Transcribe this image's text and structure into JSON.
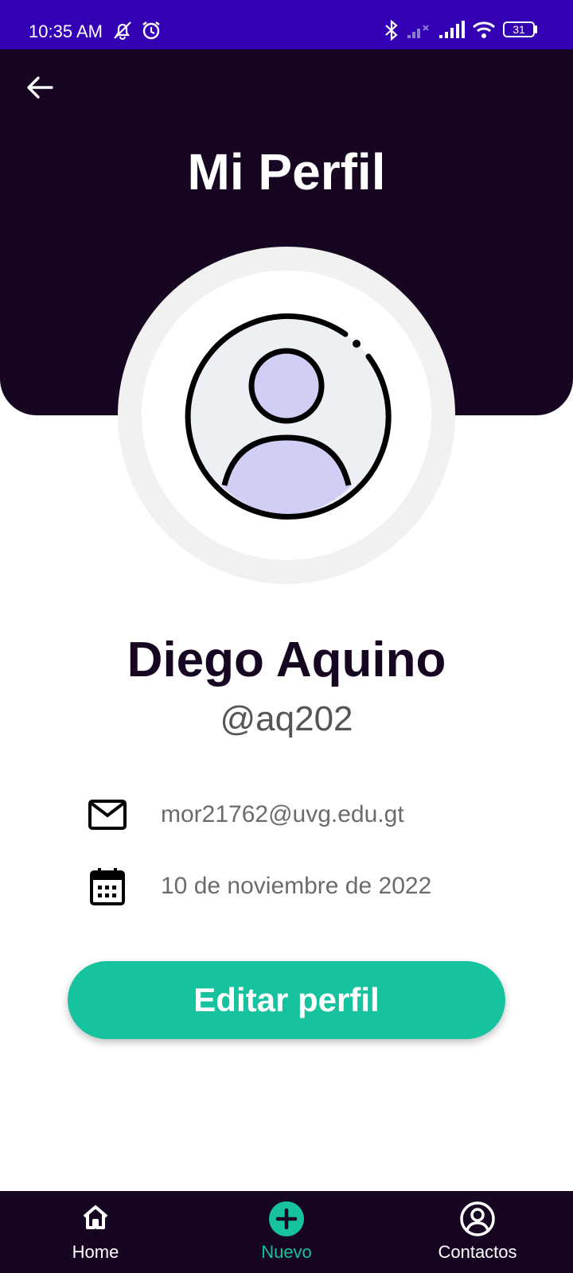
{
  "status_bar": {
    "time": "10:35 AM",
    "battery": "31",
    "icons": [
      "mute-notifications-icon",
      "alarm-icon",
      "bluetooth-icon",
      "no-signal-icon",
      "signal-icon",
      "wifi-icon",
      "battery-icon"
    ]
  },
  "header": {
    "title": "Mi Perfil",
    "back_icon": "arrow-left-icon",
    "background": "#160622"
  },
  "profile": {
    "avatar_icon": "user-avatar-icon",
    "name": "Diego Aquino",
    "handle": "@aq202",
    "email": "mor21762@uvg.edu.gt",
    "date": "10 de noviembre de 2022",
    "email_icon": "mail-icon",
    "date_icon": "calendar-icon"
  },
  "actions": {
    "edit_label": "Editar perfil",
    "edit_color": "#17c29e"
  },
  "bottom_nav": {
    "items": [
      {
        "label": "Home",
        "icon": "home-icon",
        "active": false
      },
      {
        "label": "Nuevo",
        "icon": "add-circle-icon",
        "active": true
      },
      {
        "label": "Contactos",
        "icon": "account-circle-icon",
        "active": false
      }
    ],
    "active_color": "#17c29e"
  },
  "colors": {
    "status_bar": "#3300b4",
    "primary_dark": "#160622"
  }
}
